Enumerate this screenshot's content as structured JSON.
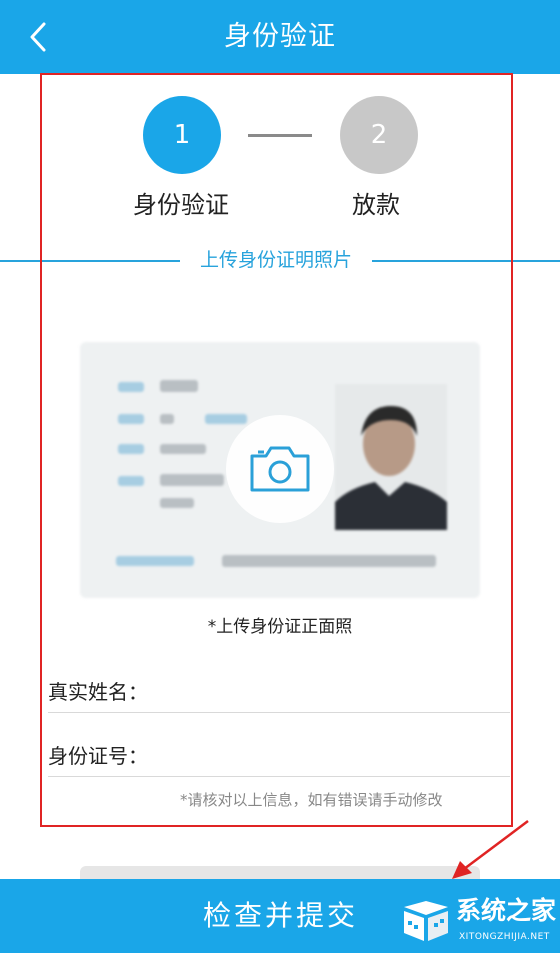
{
  "header": {
    "title": "身份验证"
  },
  "steps": [
    {
      "number": "1",
      "label": "身份验证",
      "active": true
    },
    {
      "number": "2",
      "label": "放款",
      "active": false
    }
  ],
  "section": {
    "title": "上传身份证明照片"
  },
  "upload": {
    "hint": "*上传身份证正面照"
  },
  "form": {
    "name_label": "真实姓名：",
    "name_value": "",
    "id_label": "身份证号：",
    "id_value": "",
    "note": "*请核对以上信息，如有错误请手动修改"
  },
  "submit": {
    "label": "检查并提交"
  },
  "watermark": {
    "text_cn": "系统之家",
    "text_en": "XITONGZHIJIA.NET"
  },
  "colors": {
    "primary": "#1aa6e8",
    "inactive_step": "#c8c8c8",
    "annotation_red": "#e02424",
    "section_line": "#28a3dc"
  },
  "icons": {
    "back": "chevron-left-icon",
    "camera": "camera-icon"
  }
}
